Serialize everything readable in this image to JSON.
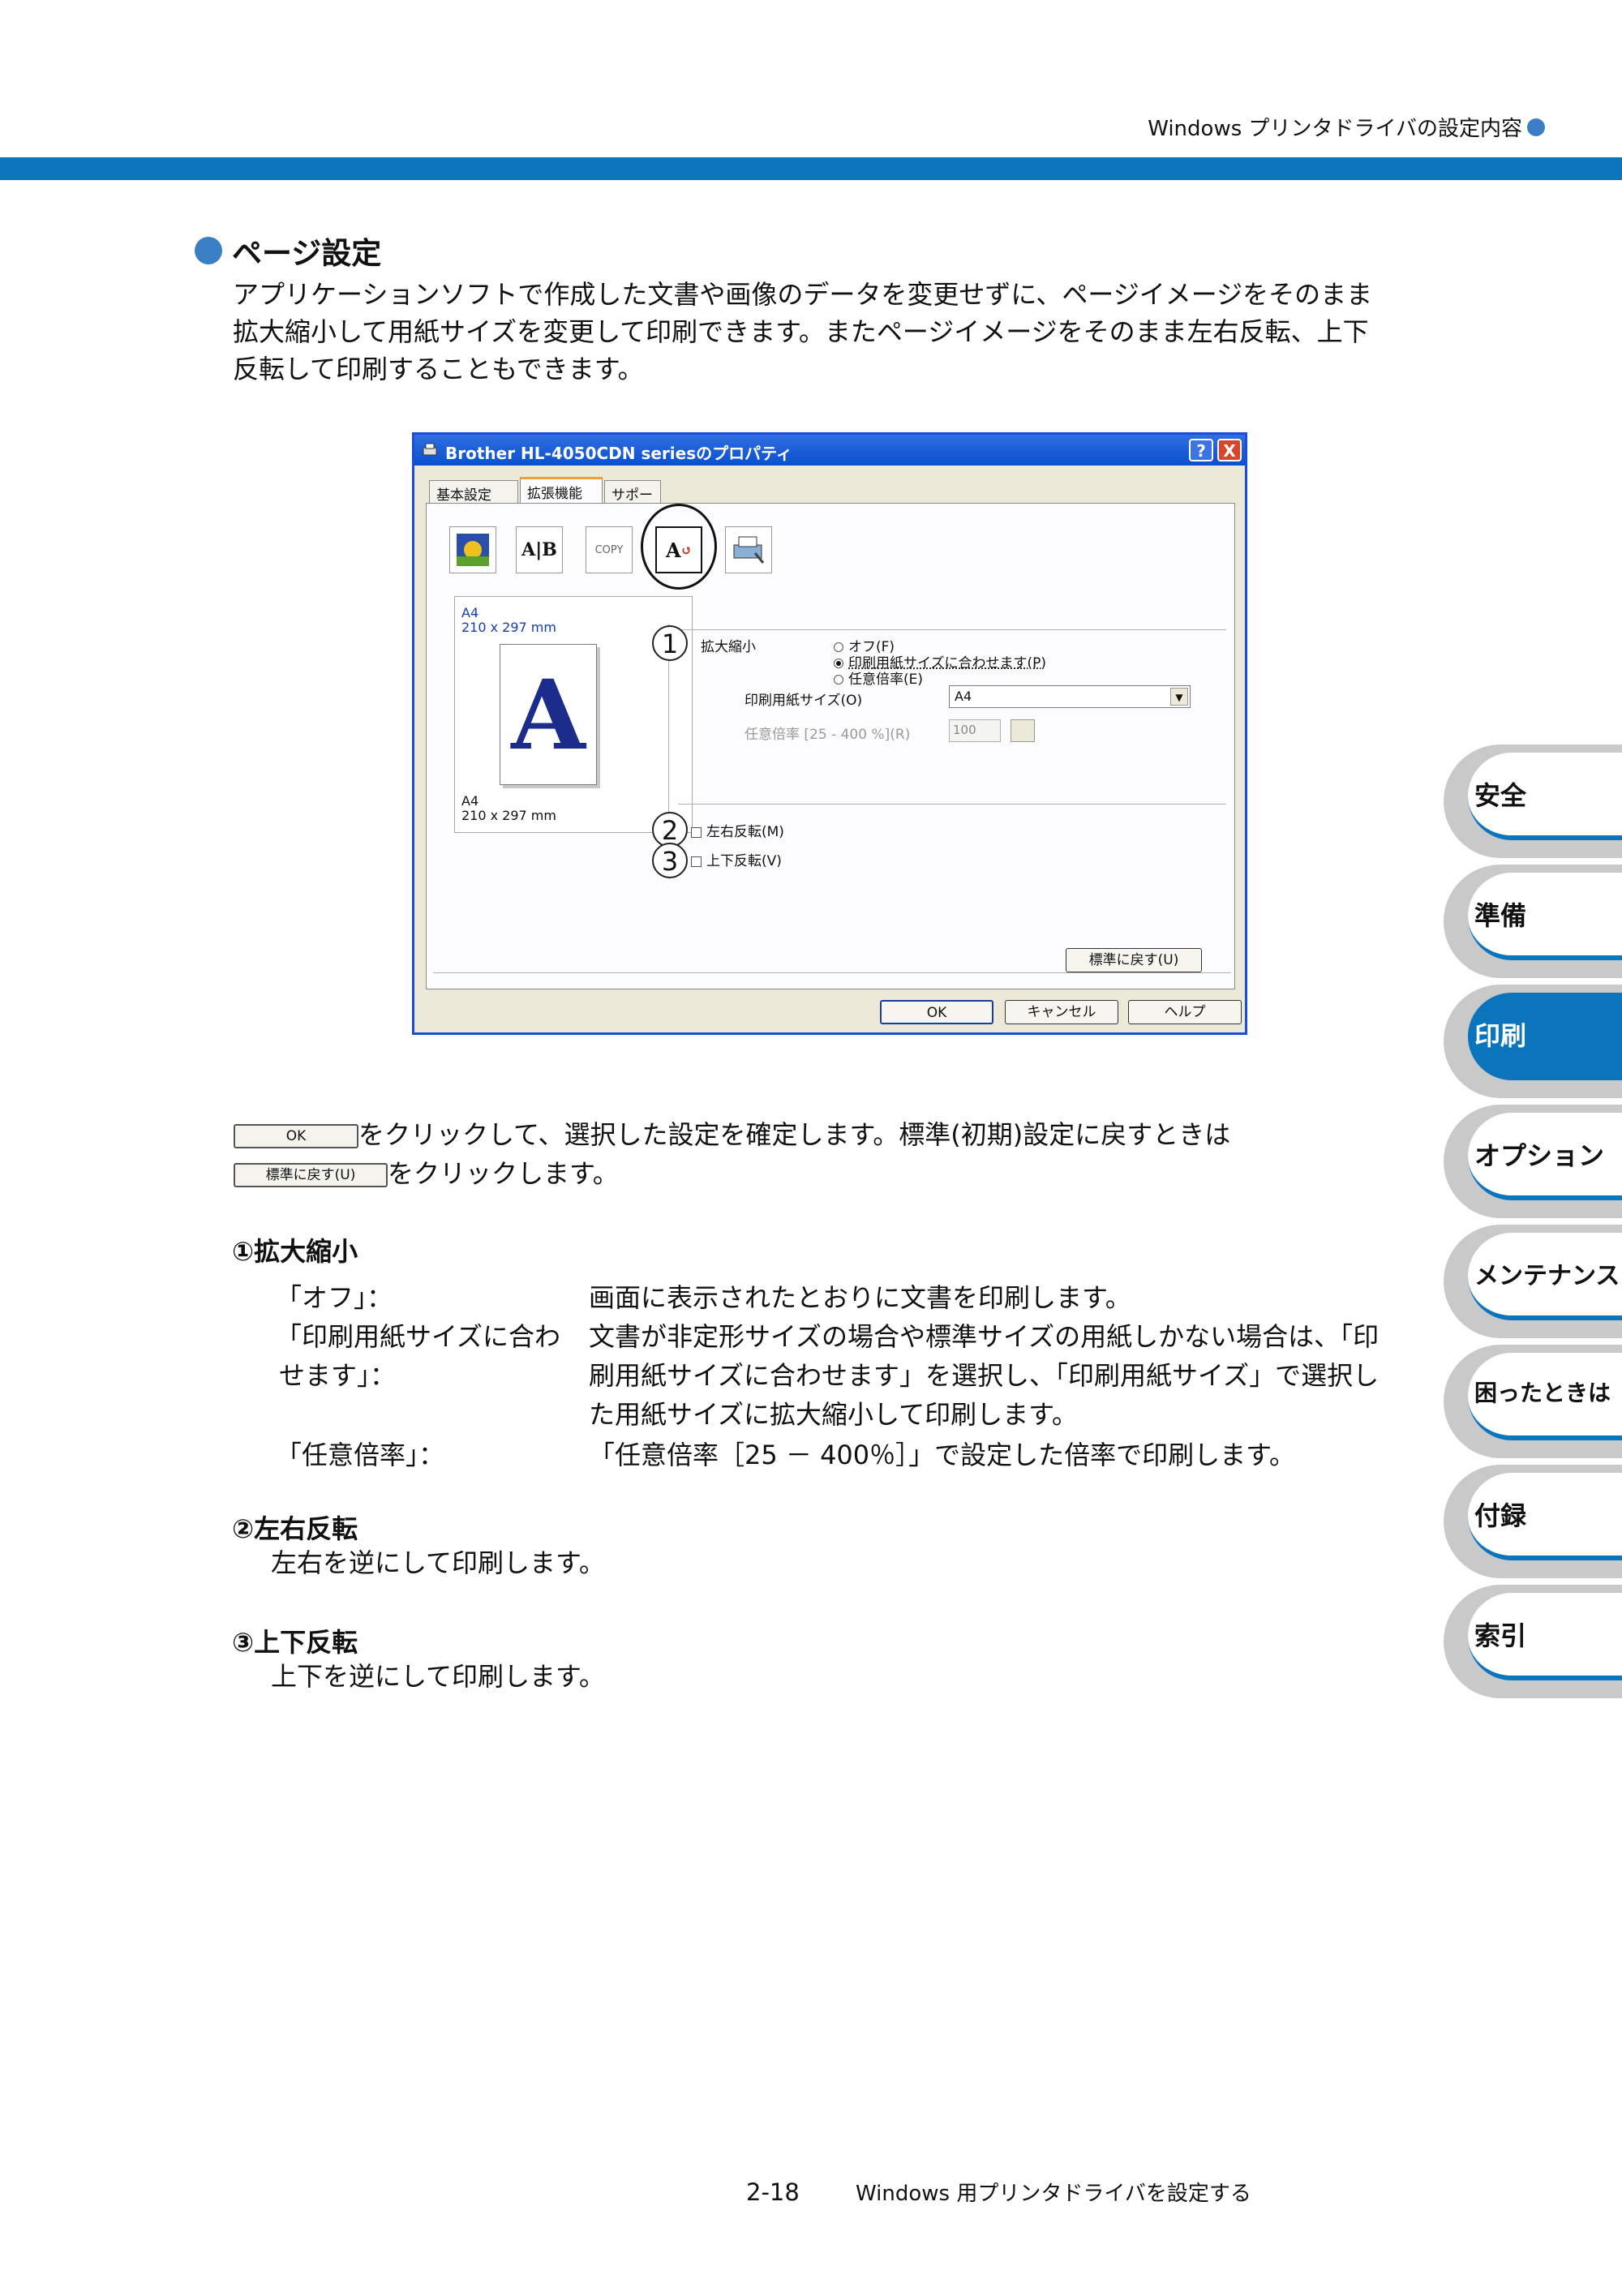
{
  "header": {
    "title": "Windows プリンタドライバの設定内容"
  },
  "section": {
    "title": "ページ設定",
    "intro": [
      "アプリケーションソフトで作成した文書や画像のデータを変更せずに、ページイメージをそのまま",
      "拡大縮小して用紙サイズを変更して印刷できます。またページイメージをそのまま左右反転、上下",
      "反転して印刷することもできます。"
    ]
  },
  "dialog": {
    "title": "Brother HL-4050CDN seriesのプロパティ",
    "help": "?",
    "close": "X",
    "tabs": [
      "基本設定",
      "拡張機能",
      "サポート"
    ],
    "preview": {
      "top_size": "A4",
      "top_dims": "210 x 297 mm",
      "letter": "A",
      "bottom_size": "A4",
      "bottom_dims": "210 x 297 mm"
    },
    "callouts": [
      "1",
      "2",
      "3"
    ],
    "scaling_label": "拡大縮小",
    "scaling_options": [
      "オフ(F)",
      "印刷用紙サイズに合わせます(P)",
      "任意倍率(E)"
    ],
    "paper_size_label": "印刷用紙サイズ(O)",
    "paper_size_value": "A4",
    "custom_ratio_label": "任意倍率 [25 - 400 %](R)",
    "custom_ratio_value": "100",
    "mirror_label": "左右反転(M)",
    "flip_label": "上下反転(V)",
    "reset_button": "標準に戻す(U)",
    "ok_button": "OK",
    "cancel_button": "キャンセル",
    "help_button": "ヘルプ",
    "tool_icons": [
      "watermark-icon",
      "ab-icon",
      "copy-icon",
      "ab-flip-icon",
      "printer-settings-icon"
    ]
  },
  "instructions": {
    "ok_button": "OK",
    "line1": "をクリックして、選択した設定を確定します。標準(初期)設定に戻すときは",
    "reset_button": "標準に戻す(U)",
    "line2": "をクリックします。"
  },
  "scaling": {
    "heading": "①拡大縮小",
    "items": [
      {
        "term": "「オフ」：",
        "def": "画面に表示されたとおりに文書を印刷します。"
      },
      {
        "term": "「印刷用紙サイズに合わ",
        "term2": "せます」：",
        "def": "文書が非定形サイズの場合や標準サイズの用紙しかない場合は、「印",
        "def2": "刷用紙サイズに合わせます」を選択し、「印刷用紙サイズ」で選択し",
        "def3": "た用紙サイズに拡大縮小して印刷します。"
      },
      {
        "term": "「任意倍率」：",
        "def": "「任意倍率［25 － 400％］」で設定した倍率で印刷します。"
      }
    ]
  },
  "mirror": {
    "heading": "②左右反転",
    "text": "左右を逆にして印刷します。"
  },
  "flip": {
    "heading": "③上下反転",
    "text": "上下を逆にして印刷します。"
  },
  "side_tabs": [
    "安全",
    "準備",
    "印刷",
    "オプション",
    "メンテナンス",
    "困ったときは",
    "付録",
    "索引"
  ],
  "side_tab_active": "印刷",
  "footer": {
    "page": "2-18",
    "title": "Windows 用プリンタドライバを設定する"
  }
}
